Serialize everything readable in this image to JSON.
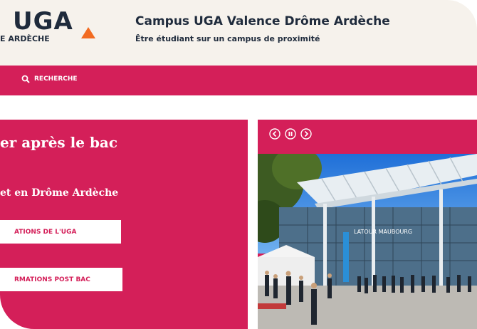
{
  "header": {
    "logo_main": "UGA",
    "logo_sub": "E ARDÈCHE",
    "title": "Campus UGA Valence Drôme Ardèche",
    "subtitle": "Être étudiant sur un campus de proximité"
  },
  "nav": {
    "search_label": "RECHERCHE",
    "search_icon": "search-icon"
  },
  "left_panel": {
    "title": "er après le bac",
    "subtitle": "et en Drôme Ardèche",
    "button1": "ATIONS DE L'UGA",
    "button2": "RMATIONS POST BAC"
  },
  "carousel": {
    "prev_icon": "chevron-left-icon",
    "pause_icon": "pause-icon",
    "next_icon": "chevron-right-icon",
    "photo_sign": "LATOUR MAUBOURG"
  },
  "colors": {
    "brand": "#d41f59",
    "header_bg": "#f6f2ec",
    "ink": "#1f2b3c",
    "accent_orange": "#f26b21"
  }
}
